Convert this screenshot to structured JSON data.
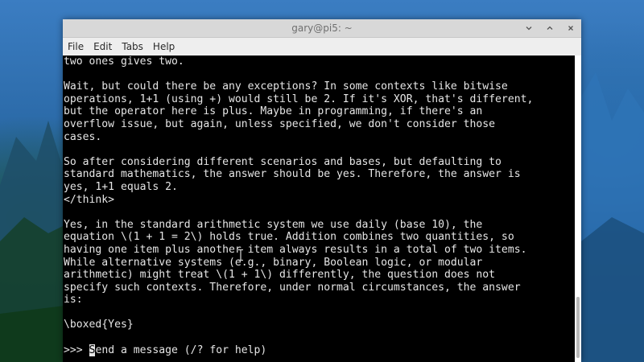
{
  "window": {
    "title": "gary@pi5: ~",
    "controls": {
      "minimize_icon": "chevron-down-icon",
      "maximize_icon": "chevron-up-icon",
      "close_icon": "close-icon"
    }
  },
  "menubar": {
    "items": [
      {
        "label": "File"
      },
      {
        "label": "Edit"
      },
      {
        "label": "Tabs"
      },
      {
        "label": "Help"
      }
    ]
  },
  "terminal": {
    "lines": [
      "two ones gives two.",
      "",
      "Wait, but could there be any exceptions? In some contexts like bitwise",
      "operations, 1+1 (using +) would still be 2. If it's XOR, that's different,",
      "but the operator here is plus. Maybe in programming, if there's an",
      "overflow issue, but again, unless specified, we don't consider those",
      "cases.",
      "",
      "So after considering different scenarios and bases, but defaulting to",
      "standard mathematics, the answer should be yes. Therefore, the answer is",
      "yes, 1+1 equals 2.",
      "</think>",
      "",
      "Yes, in the standard arithmetic system we use daily (base 10), the",
      "equation \\(1 + 1 = 2\\) holds true. Addition combines two quantities, so",
      "having one item plus another item always results in a total of two items.",
      "While alternative systems (e.g., binary, Boolean logic, or modular",
      "arithmetic) might treat \\(1 + 1\\) differently, the question does not",
      "specify such contexts. Therefore, under normal circumstances, the answer",
      "is:",
      "",
      "\\boxed{Yes}",
      ""
    ],
    "prompt": {
      "symbol": ">>> ",
      "cursor_char": "S",
      "placeholder_rest": "end a message (/? for help)"
    }
  }
}
